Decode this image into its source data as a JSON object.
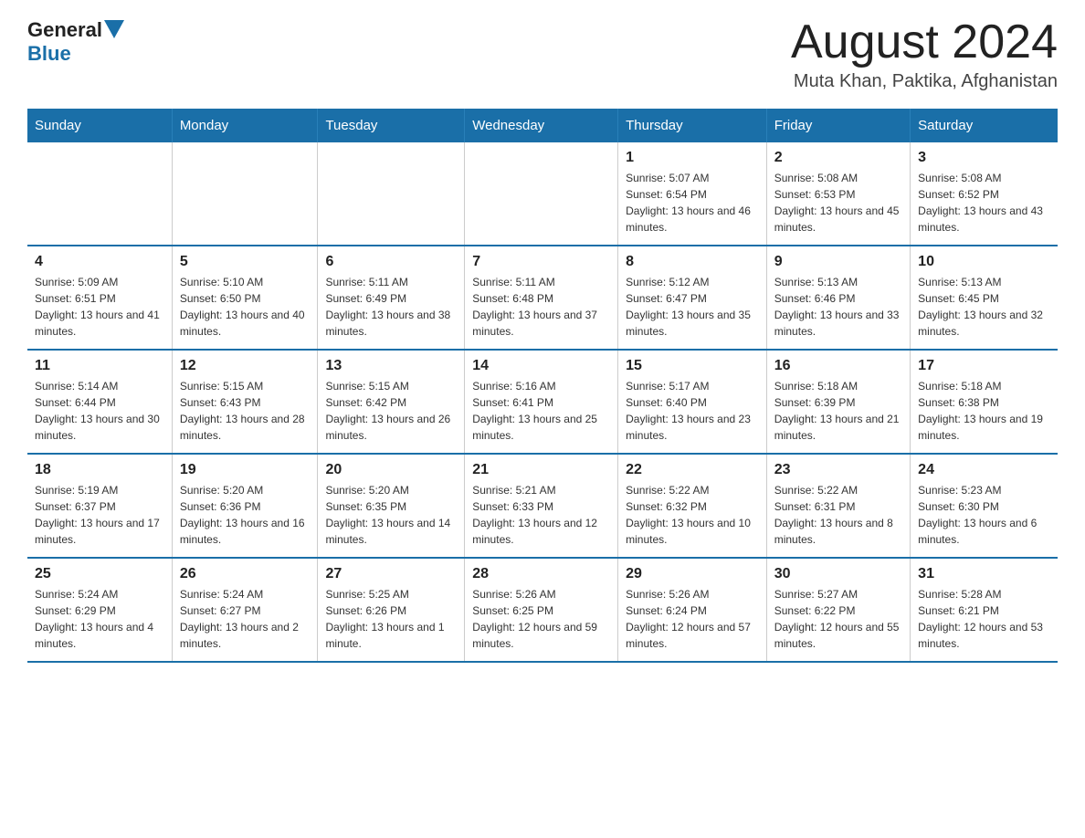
{
  "header": {
    "logo_general": "General",
    "logo_blue": "Blue",
    "title": "August 2024",
    "subtitle": "Muta Khan, Paktika, Afghanistan"
  },
  "days_of_week": [
    "Sunday",
    "Monday",
    "Tuesday",
    "Wednesday",
    "Thursday",
    "Friday",
    "Saturday"
  ],
  "weeks": [
    {
      "days": [
        {
          "number": "",
          "info": ""
        },
        {
          "number": "",
          "info": ""
        },
        {
          "number": "",
          "info": ""
        },
        {
          "number": "",
          "info": ""
        },
        {
          "number": "1",
          "info": "Sunrise: 5:07 AM\nSunset: 6:54 PM\nDaylight: 13 hours and 46 minutes."
        },
        {
          "number": "2",
          "info": "Sunrise: 5:08 AM\nSunset: 6:53 PM\nDaylight: 13 hours and 45 minutes."
        },
        {
          "number": "3",
          "info": "Sunrise: 5:08 AM\nSunset: 6:52 PM\nDaylight: 13 hours and 43 minutes."
        }
      ]
    },
    {
      "days": [
        {
          "number": "4",
          "info": "Sunrise: 5:09 AM\nSunset: 6:51 PM\nDaylight: 13 hours and 41 minutes."
        },
        {
          "number": "5",
          "info": "Sunrise: 5:10 AM\nSunset: 6:50 PM\nDaylight: 13 hours and 40 minutes."
        },
        {
          "number": "6",
          "info": "Sunrise: 5:11 AM\nSunset: 6:49 PM\nDaylight: 13 hours and 38 minutes."
        },
        {
          "number": "7",
          "info": "Sunrise: 5:11 AM\nSunset: 6:48 PM\nDaylight: 13 hours and 37 minutes."
        },
        {
          "number": "8",
          "info": "Sunrise: 5:12 AM\nSunset: 6:47 PM\nDaylight: 13 hours and 35 minutes."
        },
        {
          "number": "9",
          "info": "Sunrise: 5:13 AM\nSunset: 6:46 PM\nDaylight: 13 hours and 33 minutes."
        },
        {
          "number": "10",
          "info": "Sunrise: 5:13 AM\nSunset: 6:45 PM\nDaylight: 13 hours and 32 minutes."
        }
      ]
    },
    {
      "days": [
        {
          "number": "11",
          "info": "Sunrise: 5:14 AM\nSunset: 6:44 PM\nDaylight: 13 hours and 30 minutes."
        },
        {
          "number": "12",
          "info": "Sunrise: 5:15 AM\nSunset: 6:43 PM\nDaylight: 13 hours and 28 minutes."
        },
        {
          "number": "13",
          "info": "Sunrise: 5:15 AM\nSunset: 6:42 PM\nDaylight: 13 hours and 26 minutes."
        },
        {
          "number": "14",
          "info": "Sunrise: 5:16 AM\nSunset: 6:41 PM\nDaylight: 13 hours and 25 minutes."
        },
        {
          "number": "15",
          "info": "Sunrise: 5:17 AM\nSunset: 6:40 PM\nDaylight: 13 hours and 23 minutes."
        },
        {
          "number": "16",
          "info": "Sunrise: 5:18 AM\nSunset: 6:39 PM\nDaylight: 13 hours and 21 minutes."
        },
        {
          "number": "17",
          "info": "Sunrise: 5:18 AM\nSunset: 6:38 PM\nDaylight: 13 hours and 19 minutes."
        }
      ]
    },
    {
      "days": [
        {
          "number": "18",
          "info": "Sunrise: 5:19 AM\nSunset: 6:37 PM\nDaylight: 13 hours and 17 minutes."
        },
        {
          "number": "19",
          "info": "Sunrise: 5:20 AM\nSunset: 6:36 PM\nDaylight: 13 hours and 16 minutes."
        },
        {
          "number": "20",
          "info": "Sunrise: 5:20 AM\nSunset: 6:35 PM\nDaylight: 13 hours and 14 minutes."
        },
        {
          "number": "21",
          "info": "Sunrise: 5:21 AM\nSunset: 6:33 PM\nDaylight: 13 hours and 12 minutes."
        },
        {
          "number": "22",
          "info": "Sunrise: 5:22 AM\nSunset: 6:32 PM\nDaylight: 13 hours and 10 minutes."
        },
        {
          "number": "23",
          "info": "Sunrise: 5:22 AM\nSunset: 6:31 PM\nDaylight: 13 hours and 8 minutes."
        },
        {
          "number": "24",
          "info": "Sunrise: 5:23 AM\nSunset: 6:30 PM\nDaylight: 13 hours and 6 minutes."
        }
      ]
    },
    {
      "days": [
        {
          "number": "25",
          "info": "Sunrise: 5:24 AM\nSunset: 6:29 PM\nDaylight: 13 hours and 4 minutes."
        },
        {
          "number": "26",
          "info": "Sunrise: 5:24 AM\nSunset: 6:27 PM\nDaylight: 13 hours and 2 minutes."
        },
        {
          "number": "27",
          "info": "Sunrise: 5:25 AM\nSunset: 6:26 PM\nDaylight: 13 hours and 1 minute."
        },
        {
          "number": "28",
          "info": "Sunrise: 5:26 AM\nSunset: 6:25 PM\nDaylight: 12 hours and 59 minutes."
        },
        {
          "number": "29",
          "info": "Sunrise: 5:26 AM\nSunset: 6:24 PM\nDaylight: 12 hours and 57 minutes."
        },
        {
          "number": "30",
          "info": "Sunrise: 5:27 AM\nSunset: 6:22 PM\nDaylight: 12 hours and 55 minutes."
        },
        {
          "number": "31",
          "info": "Sunrise: 5:28 AM\nSunset: 6:21 PM\nDaylight: 12 hours and 53 minutes."
        }
      ]
    }
  ]
}
